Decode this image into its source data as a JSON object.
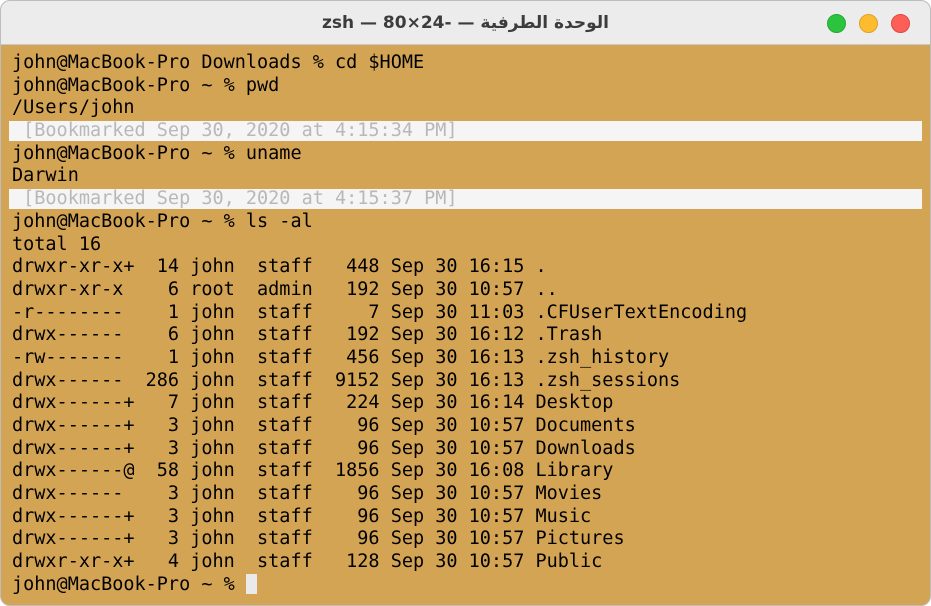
{
  "window": {
    "title": "الوحدة الطرفية — -zsh — 80×24"
  },
  "terminal": {
    "lines": {
      "l0": "john@MacBook-Pro Downloads % cd $HOME",
      "l1": "john@MacBook-Pro ~ % pwd",
      "l2": "/Users/john",
      "l3": " [Bookmarked Sep 30, 2020 at 4:15:34 PM]",
      "l4": "john@MacBook-Pro ~ % uname",
      "l5": "Darwin",
      "l6": " [Bookmarked Sep 30, 2020 at 4:15:37 PM]",
      "l7": "john@MacBook-Pro ~ % ls -al",
      "l8": "total 16",
      "l9": "drwxr-xr-x+  14 john  staff   448 Sep 30 16:15 .",
      "l10": "drwxr-xr-x    6 root  admin   192 Sep 30 10:57 ..",
      "l11": "-r--------    1 john  staff     7 Sep 30 11:03 .CFUserTextEncoding",
      "l12": "drwx------    6 john  staff   192 Sep 30 16:12 .Trash",
      "l13": "-rw-------    1 john  staff   456 Sep 30 16:13 .zsh_history",
      "l14": "drwx------  286 john  staff  9152 Sep 30 16:13 .zsh_sessions",
      "l15": "drwx------+   7 john  staff   224 Sep 30 16:14 Desktop",
      "l16": "drwx------+   3 john  staff    96 Sep 30 10:57 Documents",
      "l17": "drwx------+   3 john  staff    96 Sep 30 10:57 Downloads",
      "l18": "drwx------@  58 john  staff  1856 Sep 30 16:08 Library",
      "l19": "drwx------    3 john  staff    96 Sep 30 10:57 Movies",
      "l20": "drwx------+   3 john  staff    96 Sep 30 10:57 Music",
      "l21": "drwx------+   3 john  staff    96 Sep 30 10:57 Pictures",
      "l22": "drwxr-xr-x+   4 john  staff   128 Sep 30 10:57 Public",
      "prompt": "john@MacBook-Pro ~ % "
    }
  },
  "colors": {
    "background": "#d4a455",
    "titlebar": "#ececec",
    "bookmark_bg": "#f5f5f5",
    "bookmark_text": "#b8b8b8",
    "close": "#fd5f56",
    "minimize": "#fdbc2e",
    "zoom": "#2cc33f"
  }
}
